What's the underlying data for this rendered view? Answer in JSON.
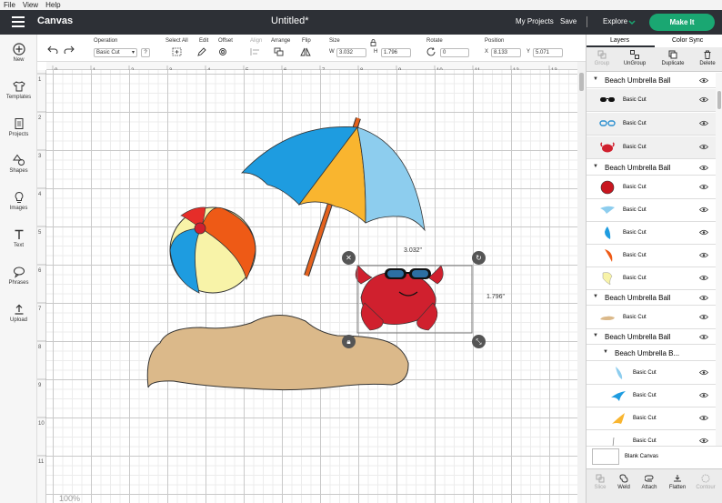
{
  "menu": [
    "File",
    "View",
    "Help"
  ],
  "header": {
    "app_title": "Canvas",
    "doc_title": "Untitled*",
    "my_projects": "My Projects",
    "save": "Save",
    "explore": "Explore",
    "make_it": "Make It"
  },
  "sidebar": [
    {
      "label": "New",
      "icon": "plus-circle-icon"
    },
    {
      "label": "Templates",
      "icon": "shirt-icon"
    },
    {
      "label": "Projects",
      "icon": "document-icon"
    },
    {
      "label": "Shapes",
      "icon": "shapes-icon"
    },
    {
      "label": "Images",
      "icon": "lightbulb-icon"
    },
    {
      "label": "Text",
      "icon": "text-icon"
    },
    {
      "label": "Phrases",
      "icon": "speech-bubble-icon"
    },
    {
      "label": "Upload",
      "icon": "upload-icon"
    }
  ],
  "toolbar": {
    "operation_label": "Operation",
    "operation_value": "Basic Cut",
    "operation_help": "?",
    "select_all": "Select All",
    "edit": "Edit",
    "offset": "Offset",
    "align": "Align",
    "arrange": "Arrange",
    "flip": "Flip",
    "size": "Size",
    "w_label": "W",
    "w_value": "3.032",
    "h_label": "H",
    "h_value": "1.796",
    "rotate": "Rotate",
    "rotate_value": "0",
    "position": "Position",
    "x_label": "X",
    "x_value": "8.133",
    "y_label": "Y",
    "y_value": "5.071"
  },
  "ruler_top": [
    "0",
    "1",
    "2",
    "3",
    "4",
    "5",
    "6",
    "7",
    "8",
    "9",
    "10",
    "11",
    "12",
    "13"
  ],
  "ruler_left": [
    "1",
    "2",
    "3",
    "4",
    "5",
    "6",
    "7",
    "8",
    "9",
    "10",
    "11"
  ],
  "canvas": {
    "width_label": "3.032\"",
    "height_label": "1.796\"",
    "zoom": "100%"
  },
  "panel": {
    "tab_layers": "Layers",
    "tab_color_sync": "Color Sync",
    "tools": [
      "Group",
      "UnGroup",
      "Duplicate",
      "Delete"
    ],
    "groups": [
      {
        "name": "Beach Umbrella Ball",
        "rows": [
          "Basic Cut",
          "Basic Cut",
          "Basic Cut"
        ]
      },
      {
        "name": "Beach Umbrella Ball",
        "rows": [
          "Basic Cut",
          "Basic Cut",
          "Basic Cut",
          "Basic Cut",
          "Basic Cut"
        ]
      },
      {
        "name": "Beach Umbrella Ball",
        "rows": [
          "Basic Cut"
        ]
      },
      {
        "name": "Beach Umbrella Ball",
        "rows": []
      },
      {
        "name": "Beach Umbrella B...",
        "rows": [
          "Basic Cut",
          "Basic Cut",
          "Basic Cut",
          "Basic Cut"
        ]
      }
    ],
    "blank_canvas": "Blank Canvas",
    "bottom_tools": [
      "Slice",
      "Weld",
      "Attach",
      "Flatten",
      "Contour"
    ]
  },
  "colors": {
    "header_bg": "#2d3036",
    "make_it": "#1aa772",
    "umbrella_blue": "#1e9ce0",
    "umbrella_yellow": "#f9b52f",
    "umbrella_light": "#8dcdee",
    "crab_red": "#d0202e",
    "sand": "#dbb98a",
    "ball_orange": "#ee5a16",
    "ball_yellow": "#f8f3a8"
  }
}
